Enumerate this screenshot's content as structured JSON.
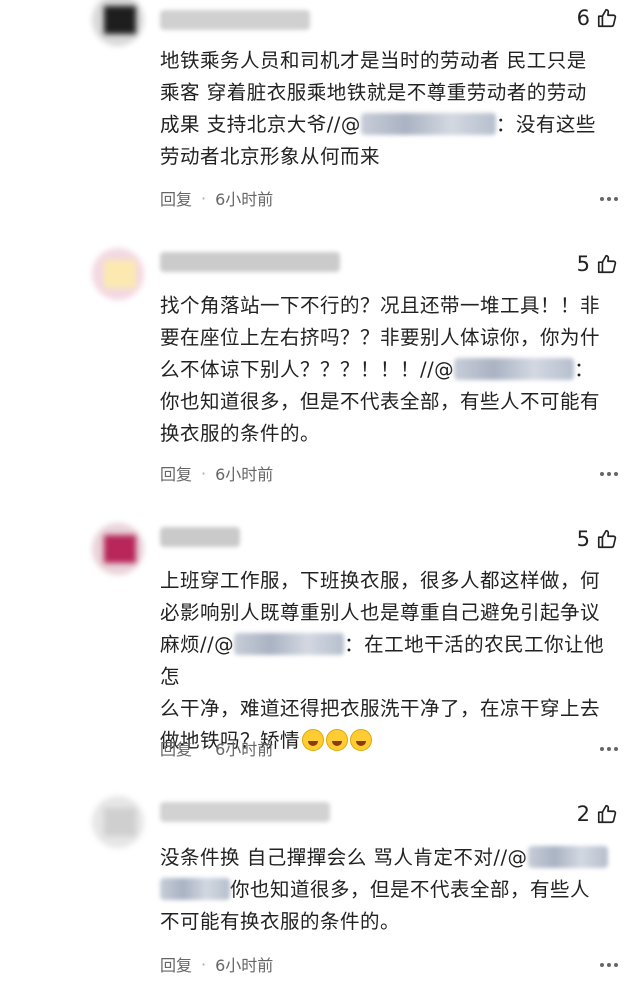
{
  "comments": [
    {
      "likes": "6",
      "lines": [
        "地铁乘务人员和司机才是当时的劳动者 民工只是",
        "乘客 穿着脏衣服乘地铁就是不尊重劳动者的劳动",
        "成果 支持北京大爷//@",
        "：没有这些",
        "劳动者北京形象从何而来"
      ],
      "reply_label": "回复",
      "time": "6小时前",
      "avatar_colors": [
        "#d9d9d9",
        "#1e1e1e"
      ],
      "name_color": "#cfcfcf"
    },
    {
      "likes": "5",
      "lines": [
        "找个角落站一下不行的？况且还带一堆工具！！非",
        "要在座位上左右挤吗？？非要别人体谅你，你为什",
        "么不体谅下别人？？？！！！//@",
        "：",
        "你也知道很多，但是不代表全部，有些人不可能有",
        "换衣服的条件的。"
      ],
      "reply_label": "回复",
      "time": "6小时前",
      "avatar_colors": [
        "#f3d9e2",
        "#fbe9b0"
      ],
      "name_color": "#c9c9c9"
    },
    {
      "likes": "5",
      "lines": [
        "上班穿工作服，下班换衣服，很多人都这样做，何",
        "必影响别人既尊重别人也是尊重自己避免引起争议",
        "麻烦//@",
        "：在工地干活的农民工你让他怎",
        "么干净，难道还得把衣服洗干净了，在凉干穿上去",
        "做地铁吗？矫情"
      ],
      "reply_label": "回复",
      "time": "6小时前",
      "avatar_colors": [
        "#e9d3d9",
        "#b8265a"
      ],
      "name_color": "#cacaca"
    },
    {
      "likes": "2",
      "lines": [
        "没条件换 自己撣撣会么 骂人肯定不对//@",
        "你也知道很多，但是不代表全部，有些人",
        "不可能有换衣服的条件的。"
      ],
      "reply_label": "回复",
      "time": "6小时前",
      "avatar_colors": [
        "#e6e6e6",
        "#cfcfcf"
      ],
      "name_color": "#d2d2d2"
    }
  ],
  "icons": {
    "like": "thumbs-up-icon",
    "more": "more-dots-icon",
    "emoji": "laughing-crying-emoji"
  },
  "colors": {
    "text": "#222222",
    "meta": "#666666",
    "mask": "#b8c0cd"
  }
}
